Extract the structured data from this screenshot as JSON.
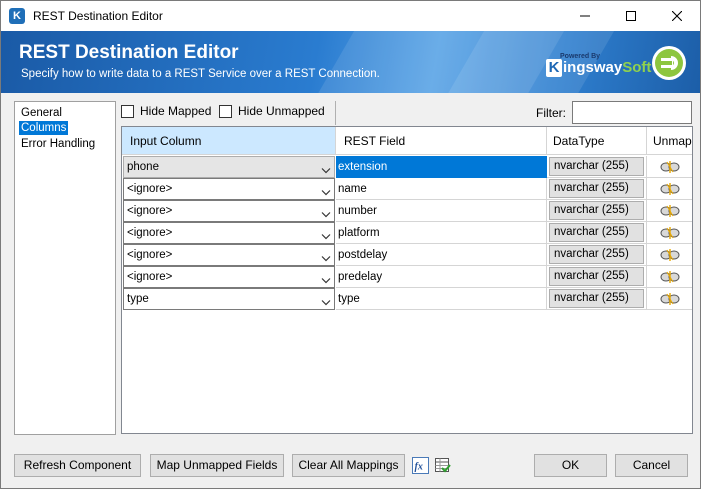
{
  "window": {
    "title": "REST Destination Editor"
  },
  "banner": {
    "title": "REST Destination Editor",
    "subtitle": "Specify how to write data to a REST Service over a REST Connection.",
    "logo_powered": "Powered By",
    "logo_brand": "ingsway",
    "logo_brand_k": "K",
    "logo_soft": "Soft"
  },
  "nav": {
    "items": [
      {
        "label": "General"
      },
      {
        "label": "Columns"
      },
      {
        "label": "Error Handling"
      }
    ],
    "selected": "Columns"
  },
  "toolbar": {
    "hide_mapped": "Hide Mapped",
    "hide_unmapped": "Hide Unmapped",
    "filter_label": "Filter:",
    "filter_value": ""
  },
  "grid": {
    "headers": [
      "Input Column",
      "REST Field",
      "DataType",
      "Unmap"
    ],
    "rows": [
      {
        "input": "phone",
        "field": "extension",
        "type": "nvarchar (255)"
      },
      {
        "input": "<ignore>",
        "field": "name",
        "type": "nvarchar (255)"
      },
      {
        "input": "<ignore>",
        "field": "number",
        "type": "nvarchar (255)"
      },
      {
        "input": "<ignore>",
        "field": "platform",
        "type": "nvarchar (255)"
      },
      {
        "input": "<ignore>",
        "field": "postdelay",
        "type": "nvarchar (255)"
      },
      {
        "input": "<ignore>",
        "field": "predelay",
        "type": "nvarchar (255)"
      },
      {
        "input": "type",
        "field": "type",
        "type": "nvarchar (255)"
      }
    ]
  },
  "buttons": {
    "refresh": "Refresh Component",
    "map_unmapped": "Map Unmapped Fields",
    "clear_all": "Clear All Mappings",
    "ok": "OK",
    "cancel": "Cancel"
  },
  "icons": {
    "expression": "fx-icon",
    "table": "table-check-icon"
  },
  "colors": {
    "accent": "#0078d7",
    "banner": "#1a5aa6",
    "header_selected": "#cce8ff"
  }
}
